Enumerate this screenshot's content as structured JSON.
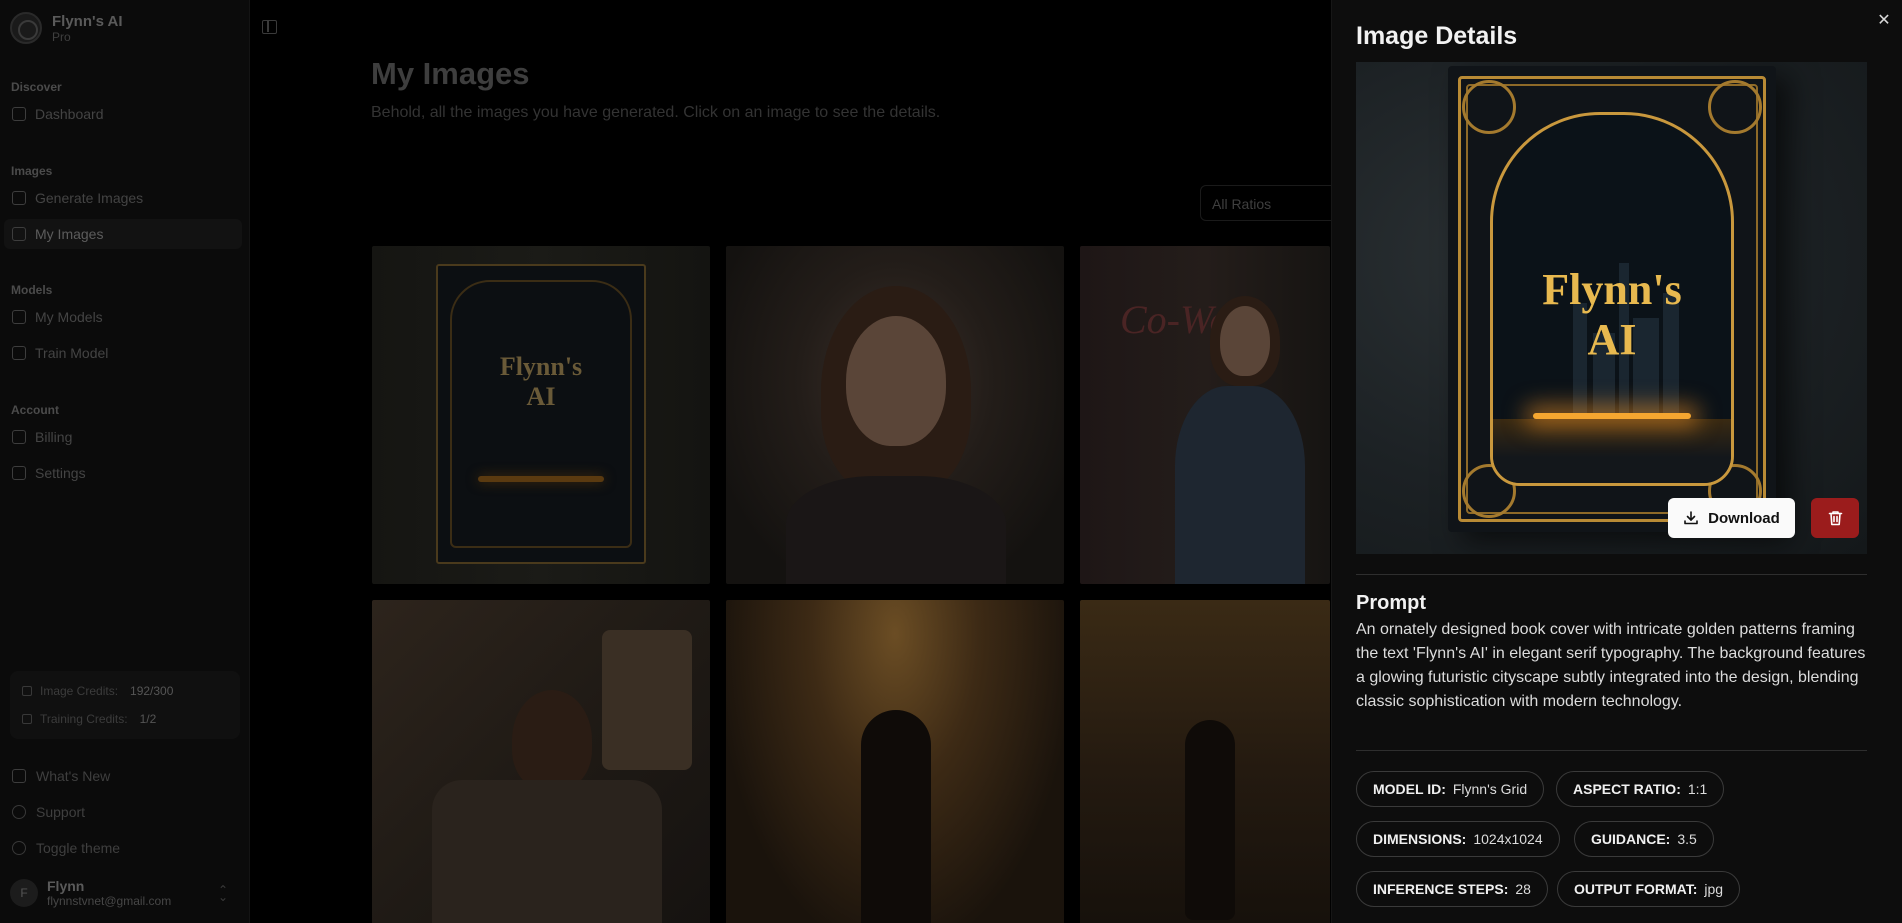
{
  "brand": {
    "name": "Flynn's AI",
    "plan": "Pro"
  },
  "sidebar": {
    "sections": {
      "discover": "Discover",
      "images": "Images",
      "models": "Models",
      "account": "Account"
    },
    "items": {
      "dashboard": "Dashboard",
      "generate_images": "Generate Images",
      "my_images": "My Images",
      "my_models": "My Models",
      "train_model": "Train Model",
      "billing": "Billing",
      "settings": "Settings"
    },
    "credits": {
      "image_label": "Image Credits:",
      "image_value": "192/300",
      "training_label": "Training Credits:",
      "training_value": "1/2"
    },
    "bottom": {
      "whats_new": "What's New",
      "support": "Support",
      "toggle_theme": "Toggle theme"
    },
    "user": {
      "initial": "F",
      "name": "Flynn",
      "email": "flynnstvnet@gmail.com"
    }
  },
  "main": {
    "title": "My Images",
    "subtitle": "Behold, all the images you have generated. Click on an image to see the details.",
    "ratio_filter": "All Ratios",
    "tiles": {
      "book_title_line1": "Flynn's",
      "book_title_line2": "AI",
      "neon_sign": "Co-Work"
    }
  },
  "details": {
    "title": "Image Details",
    "close_icon": "close-icon",
    "preview": {
      "book_title_line1": "Flynn's",
      "book_title_line2": "AI"
    },
    "download_label": "Download",
    "prompt_heading": "Prompt",
    "prompt_text": "An ornately designed book cover with intricate golden patterns framing the text 'Flynn's AI' in elegant serif typography. The background features a glowing futuristic cityscape subtly integrated into the design, blending classic sophistication with modern technology.",
    "meta": {
      "model_id_label": "MODEL ID:",
      "model_id_value": "Flynn's Grid",
      "aspect_ratio_label": "ASPECT RATIO:",
      "aspect_ratio_value": "1:1",
      "dimensions_label": "DIMENSIONS:",
      "dimensions_value": "1024x1024",
      "guidance_label": "GUIDANCE:",
      "guidance_value": "3.5",
      "inference_steps_label": "INFERENCE STEPS:",
      "inference_steps_value": "28",
      "output_format_label": "OUTPUT FORMAT:",
      "output_format_value": "jpg"
    }
  },
  "colors": {
    "delete": "#9b1c1c",
    "panel_bg": "#0d0d0d",
    "gold": "#c9983d"
  }
}
